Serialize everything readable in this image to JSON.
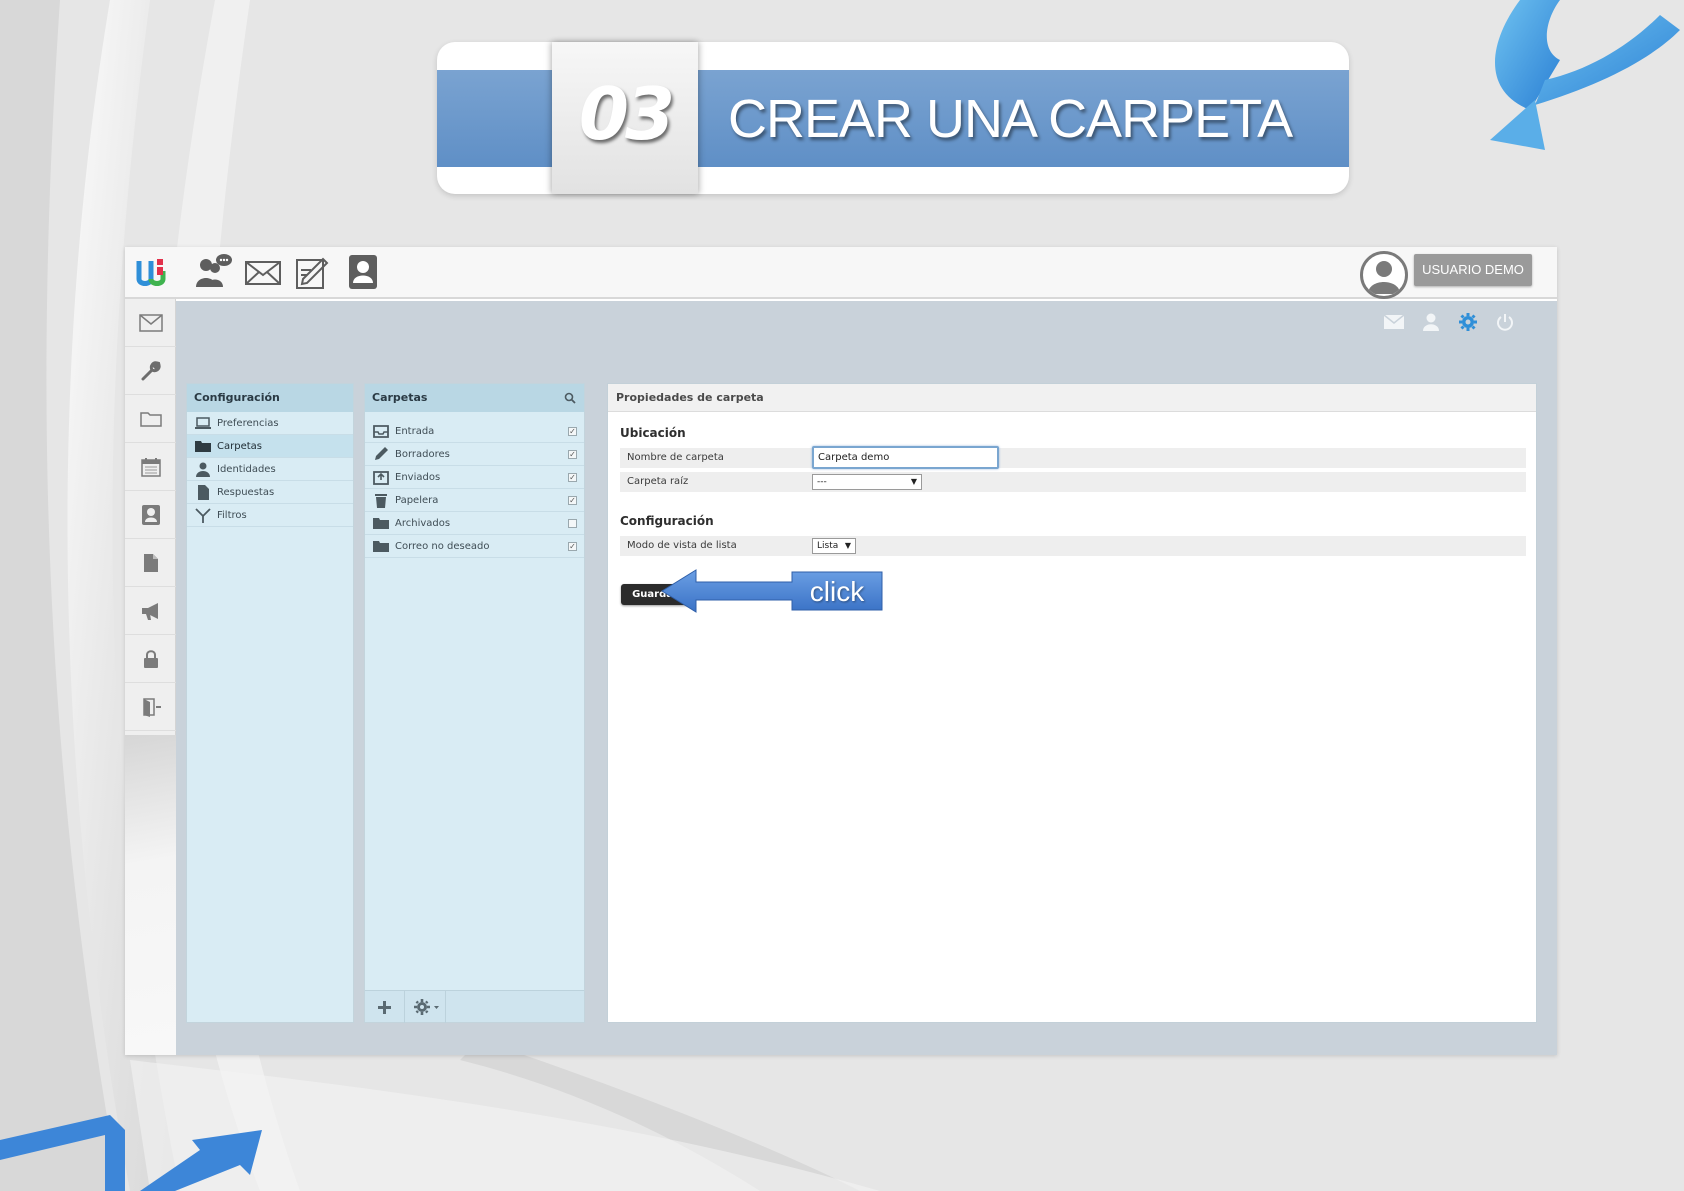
{
  "banner": {
    "number": "03",
    "title": "CREAR UNA CARPETA"
  },
  "topbar": {
    "app_icons": [
      "chat-icon",
      "mail-icon",
      "compose-icon",
      "contacts-icon"
    ],
    "user_label": "USUARIO DEMO"
  },
  "leftnav": {
    "items": [
      "mail-icon",
      "wrench-icon",
      "folder-icon",
      "calendar-icon",
      "contact-card-icon",
      "document-icon",
      "megaphone-icon",
      "lock-icon",
      "exit-icon"
    ]
  },
  "utility_icons": [
    "mail-icon",
    "user-icon",
    "gear-icon",
    "power-icon"
  ],
  "config_panel": {
    "title": "Configuración",
    "items": [
      {
        "label": "Preferencias",
        "icon": "laptop-icon",
        "selected": false
      },
      {
        "label": "Carpetas",
        "icon": "folder-icon",
        "selected": true
      },
      {
        "label": "Identidades",
        "icon": "person-icon",
        "selected": false
      },
      {
        "label": "Respuestas",
        "icon": "document-icon",
        "selected": false
      },
      {
        "label": "Filtros",
        "icon": "filter-icon",
        "selected": false
      }
    ]
  },
  "folders_panel": {
    "title": "Carpetas",
    "items": [
      {
        "label": "Entrada",
        "icon": "inbox-icon",
        "subscribed": true
      },
      {
        "label": "Borradores",
        "icon": "pencil-icon",
        "subscribed": true
      },
      {
        "label": "Enviados",
        "icon": "sent-icon",
        "subscribed": true
      },
      {
        "label": "Papelera",
        "icon": "trash-icon",
        "subscribed": true
      },
      {
        "label": "Archivados",
        "icon": "folder-icon",
        "subscribed": false
      },
      {
        "label": "Correo no deseado",
        "icon": "folder-icon",
        "subscribed": true
      }
    ]
  },
  "properties": {
    "title": "Propiedades de carpeta",
    "location_section": "Ubicación",
    "name_label": "Nombre de carpeta",
    "name_value": "Carpeta demo",
    "parent_label": "Carpeta raíz",
    "parent_value": "---",
    "config_section": "Configuración",
    "view_mode_label": "Modo de vista de lista",
    "view_mode_value": "Lista",
    "save_label": "Guardar"
  },
  "annotation": {
    "label": "click"
  },
  "colors": {
    "banner_blue": "#6a98cc",
    "panel_bg": "#d9ecf4",
    "panel_head": "#b9d7e4",
    "content_bg": "#c9d2da",
    "accent_gear": "#2f8fd8",
    "arrow_blue": "#4a86d6"
  }
}
